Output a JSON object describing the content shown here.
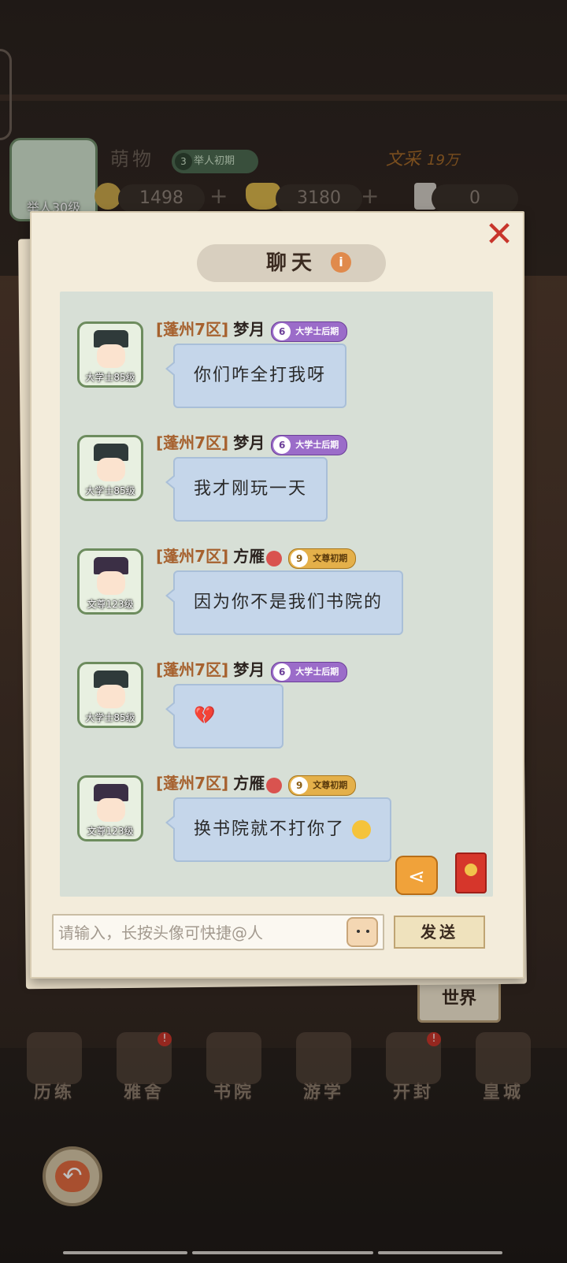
{
  "player": {
    "name": "萌物",
    "avatar_level": "举人30级",
    "rank_num": "3",
    "rank_label": "举人初期",
    "wencai_label": "文采",
    "wencai_value": "19万"
  },
  "resources": [
    {
      "icon": "coin-icon",
      "value": "1498"
    },
    {
      "icon": "gold-ingot-icon",
      "value": "3180"
    },
    {
      "icon": "scroll-ticket-icon",
      "value": "0"
    }
  ],
  "dialog": {
    "title": "聊天",
    "info": "i",
    "close": "✕"
  },
  "messages": [
    {
      "server": "[蓬州7区]",
      "name": "梦月",
      "avatar_rank": "大学士85级",
      "badge_num": "6",
      "badge_label": "大学士后期",
      "badge_color": "#9b6cc9",
      "text": "你们咋全打我呀"
    },
    {
      "server": "[蓬州7区]",
      "name": "梦月",
      "avatar_rank": "大学士85级",
      "badge_num": "6",
      "badge_label": "大学士后期",
      "badge_color": "#9b6cc9",
      "text": "我才刚玩一天"
    },
    {
      "server": "[蓬州7区]",
      "name": "方雁",
      "avatar_rank": "文尊123级",
      "badge_num": "9",
      "badge_label": "文尊初期",
      "badge_color": "#e4b04a",
      "text": "因为你不是我们书院的"
    },
    {
      "server": "[蓬州7区]",
      "name": "梦月",
      "avatar_rank": "大学士85级",
      "badge_num": "6",
      "badge_label": "大学士后期",
      "badge_color": "#9b6cc9",
      "text": "💔"
    },
    {
      "server": "[蓬州7区]",
      "name": "方雁",
      "avatar_rank": "文尊123级",
      "badge_num": "9",
      "badge_label": "文尊初期",
      "badge_color": "#e4b04a",
      "text": "换书院就不打你了"
    }
  ],
  "input": {
    "placeholder": "请输入，长按头像可快捷@人"
  },
  "send_label": "发送",
  "channel_tab": "世界",
  "nav": [
    {
      "label": "历练",
      "badge": ""
    },
    {
      "label": "雅舍",
      "badge": "!"
    },
    {
      "label": "书院",
      "badge": ""
    },
    {
      "label": "游学",
      "badge": ""
    },
    {
      "label": "开封",
      "badge": "!"
    },
    {
      "label": "皇城",
      "badge": ""
    }
  ],
  "colors": {
    "accent_red": "#c8352b",
    "bubble": "#c5d6ea",
    "server_tag": "#a6612e",
    "dialog_bg": "#f3ecdb"
  }
}
